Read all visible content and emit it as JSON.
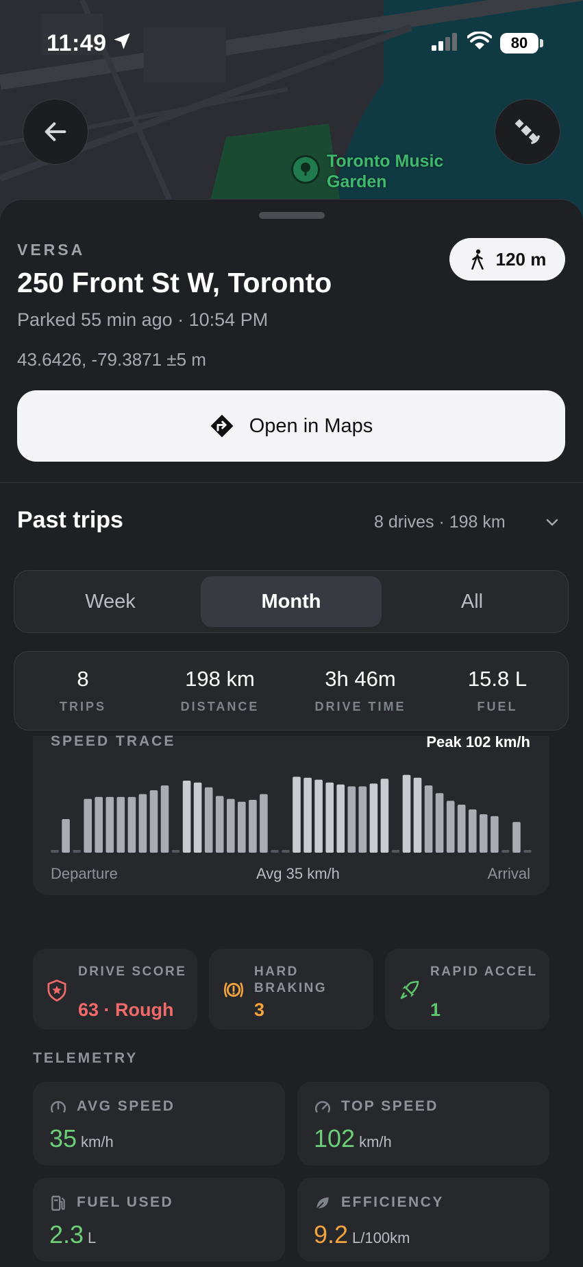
{
  "status_bar": {
    "time": "11:49",
    "battery": "80"
  },
  "map": {
    "poi_label": "Toronto Music Garden"
  },
  "parking": {
    "brand": "VERSA",
    "address": "250 Front St W, Toronto",
    "parked": "Parked 55 min ago · 10:54 PM",
    "coords": "43.6426, -79.3871 ±5 m",
    "walk_distance": "120 m",
    "open_maps_label": "Open in Maps"
  },
  "trips": {
    "title": "Past trips",
    "summary": "8 drives · 198 km",
    "tabs": [
      {
        "label": "Week",
        "active": false
      },
      {
        "label": "Month",
        "active": true
      },
      {
        "label": "All",
        "active": false
      }
    ],
    "stats": [
      {
        "value": "8",
        "label": "TRIPS"
      },
      {
        "value": "198 km",
        "label": "DISTANCE"
      },
      {
        "value": "3h 46m",
        "label": "DRIVE TIME"
      },
      {
        "value": "15.8 L",
        "label": "FUEL"
      }
    ]
  },
  "speed_trace": {
    "title": "SPEED TRACE",
    "peak": "Peak 102 km/h",
    "departure": "Departure",
    "avg": "Avg 35 km/h",
    "arrival": "Arrival"
  },
  "chart_data": {
    "type": "bar",
    "values": [
      0,
      0.35,
      0,
      0.56,
      0.58,
      0.58,
      0.58,
      0.58,
      0.61,
      0.65,
      0.7,
      0,
      0.75,
      0.73,
      0.68,
      0.59,
      0.56,
      0.53,
      0.55,
      0.61,
      0,
      0,
      0.79,
      0.78,
      0.76,
      0.73,
      0.71,
      0.69,
      0.69,
      0.72,
      0.77,
      0,
      0.81,
      0.78,
      0.7,
      0.62,
      0.54,
      0.5,
      0.45,
      0.4,
      0.38,
      0,
      0.32,
      0
    ],
    "ylim": [
      0,
      1
    ]
  },
  "scores": [
    {
      "label": "DRIVE SCORE",
      "value": "63 · Rough",
      "color": "#f06a6a"
    },
    {
      "label": "HARD BRAKING",
      "value": "3",
      "color": "#f2a33c"
    },
    {
      "label": "RAPID ACCEL",
      "value": "1",
      "color": "#5fc46e"
    }
  ],
  "telemetry": {
    "title": "TELEMETRY",
    "cards": [
      {
        "label": "AVG SPEED",
        "value": "35",
        "unit": "km/h",
        "color": "#6ccf78"
      },
      {
        "label": "TOP SPEED",
        "value": "102",
        "unit": "km/h",
        "color": "#6ccf78"
      },
      {
        "label": "FUEL USED",
        "value": "2.3",
        "unit": "L",
        "color": "#6ccf78"
      },
      {
        "label": "EFFICIENCY",
        "value": "9.2",
        "unit": "L/100km",
        "color": "#f2a33c"
      }
    ]
  }
}
